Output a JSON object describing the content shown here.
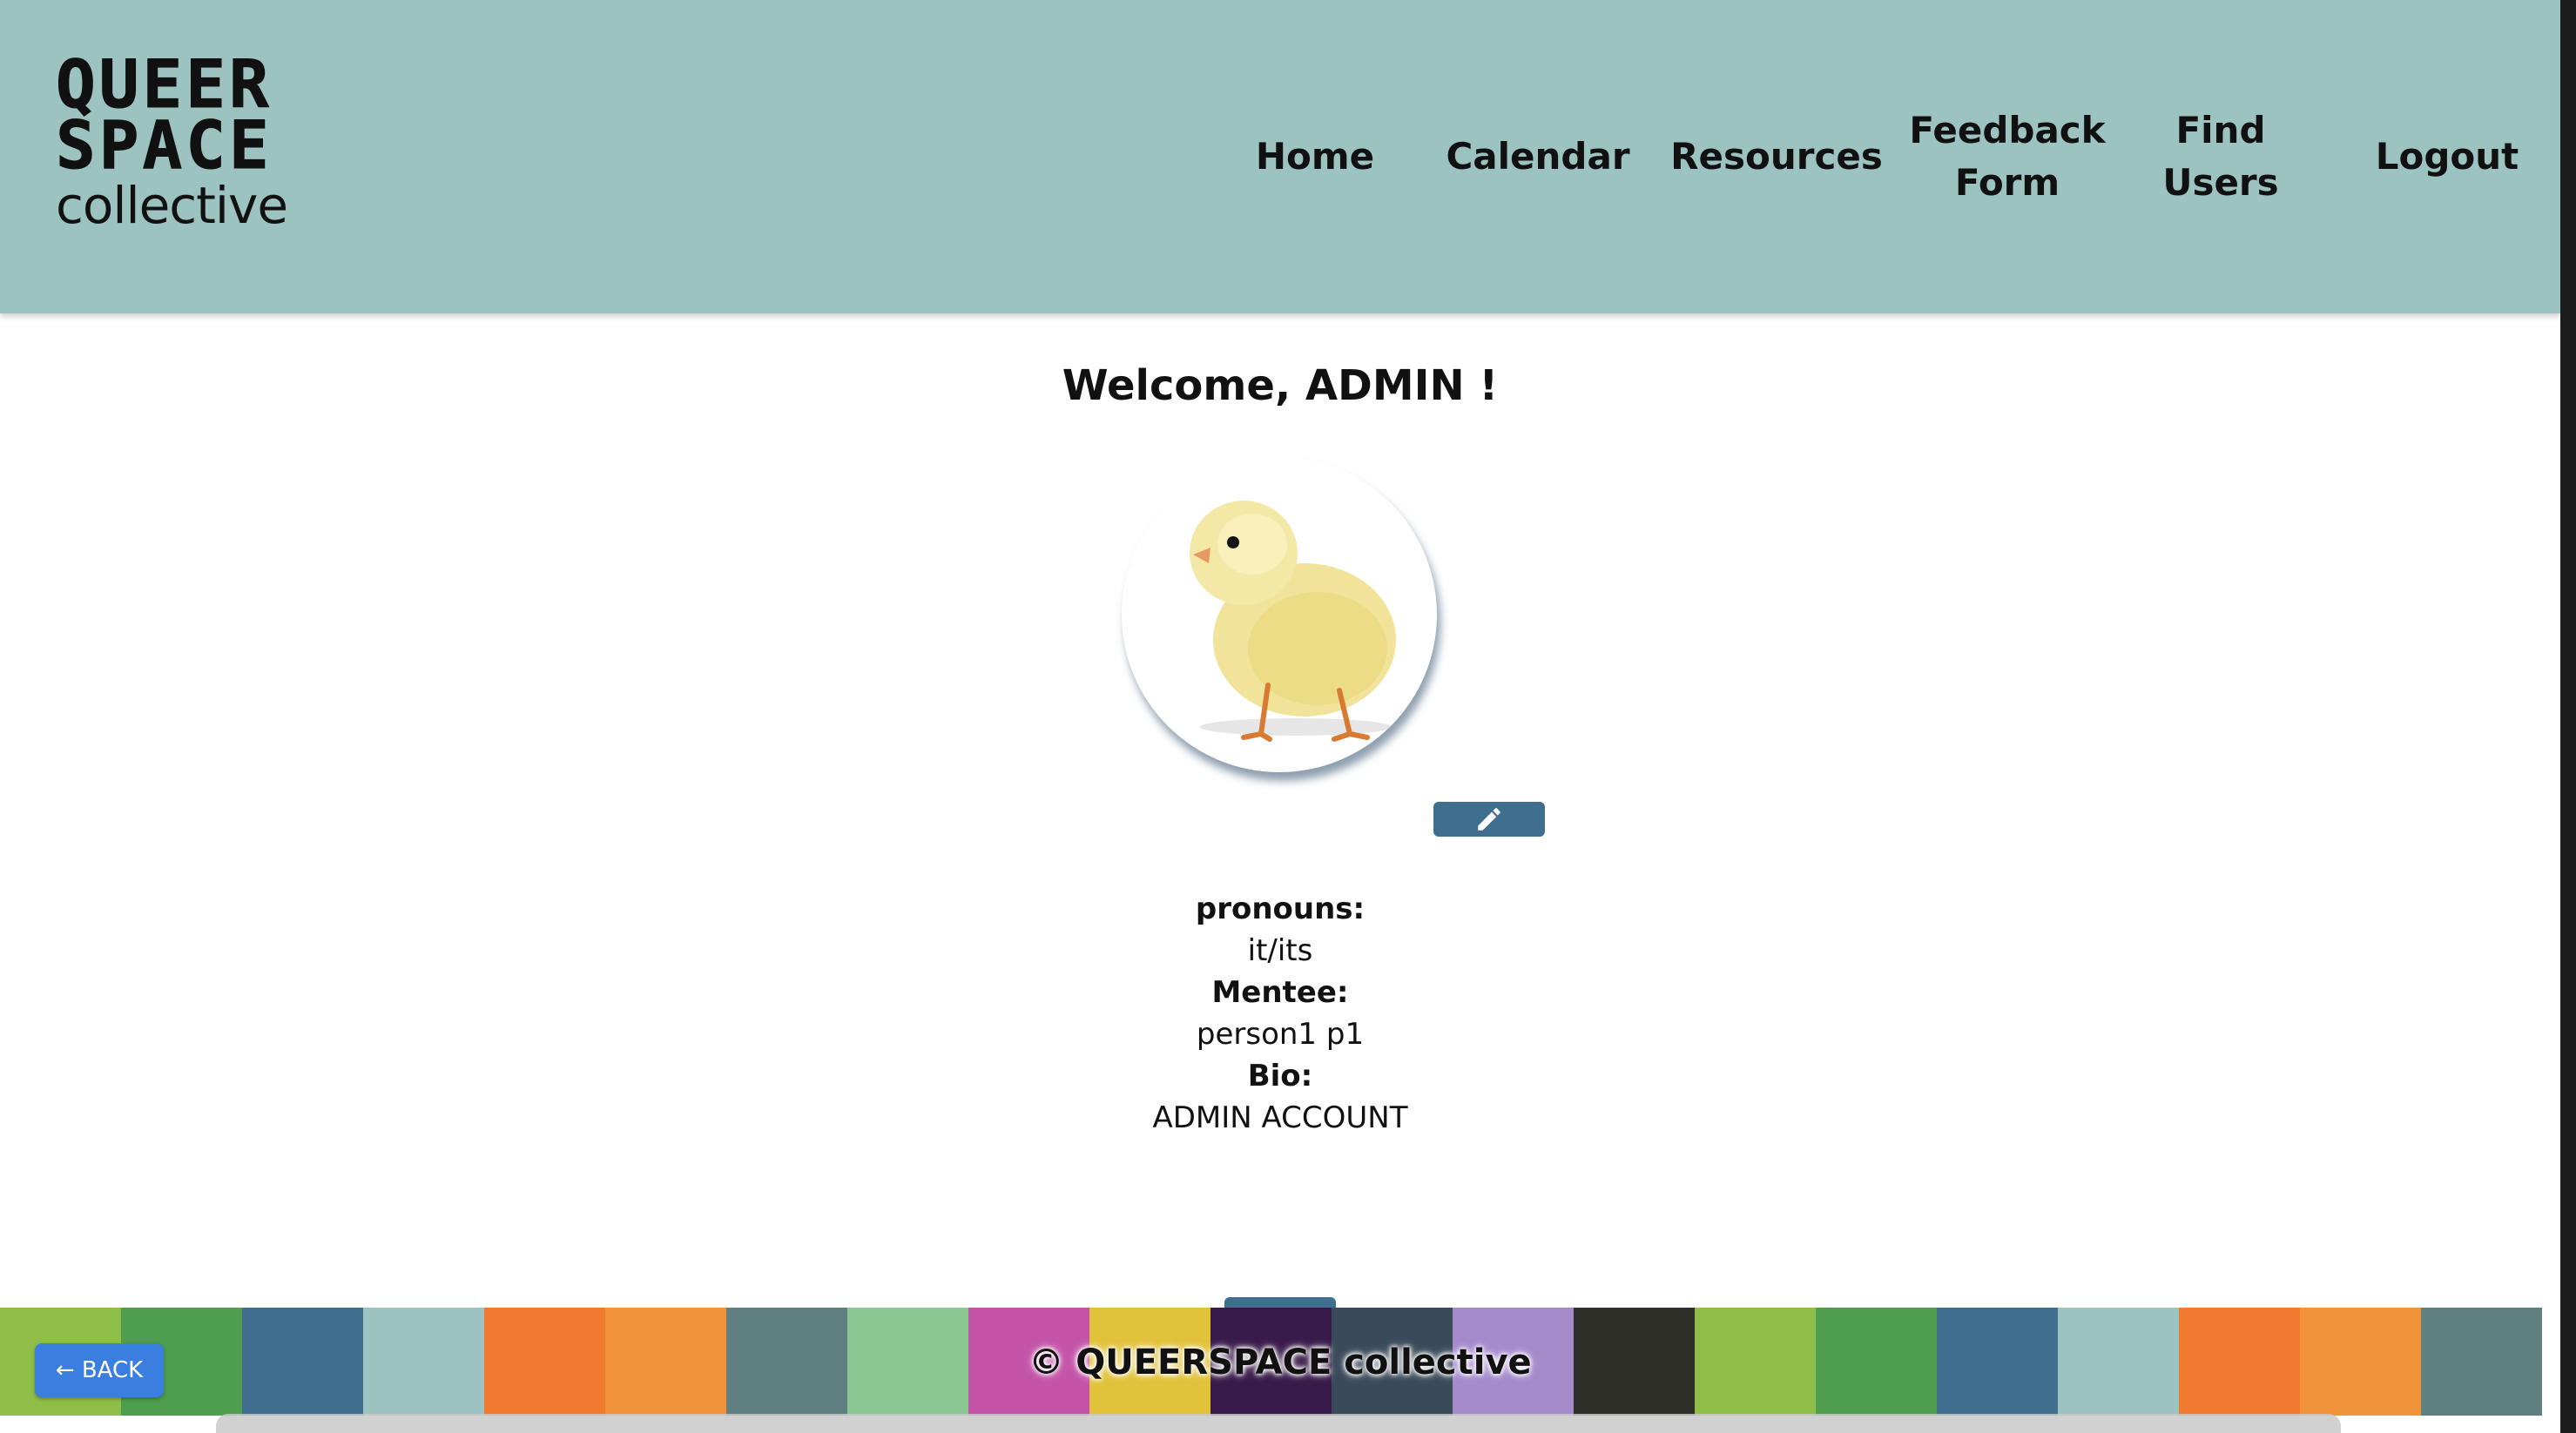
{
  "header": {
    "logo": {
      "line1": "QUEER",
      "line2": "SPACE",
      "line3": "collective"
    },
    "nav": [
      {
        "label": "Home"
      },
      {
        "label": "Calendar"
      },
      {
        "label": "Resources"
      },
      {
        "label": "Feedback Form"
      },
      {
        "label": "Find Users"
      },
      {
        "label": "Logout"
      }
    ]
  },
  "main": {
    "welcome": "Welcome, ADMIN !",
    "avatar_icon": "chick-image",
    "edit_icon": "pencil-icon",
    "fields": [
      {
        "label": "pronouns:",
        "value": "it/its"
      },
      {
        "label": "Mentee:",
        "value": "person1 p1"
      },
      {
        "label": "Bio:",
        "value": "ADMIN ACCOUNT"
      }
    ]
  },
  "footer": {
    "copyright": "© QUEERSPACE collective",
    "back_label": "← BACK",
    "tile_colors": [
      "#8fbf48",
      "#4f9e4f",
      "#3f6e8e",
      "#9dc3c0",
      "#f07a2f",
      "#f0933a",
      "#5f7f80",
      "#8ac792",
      "#c454a8",
      "#e2c23a",
      "#3a1a4a",
      "#3a4a5a",
      "#a58acc",
      "#2f2f2a",
      "#8fbf48",
      "#4f9e4f",
      "#3f6e8e",
      "#9dc3c0",
      "#f07a2f",
      "#f0933a",
      "#5f7f80"
    ]
  },
  "colors": {
    "header_bg": "#9dc3c0",
    "edit_button": "#3f6e8e",
    "back_button": "#3a7ee0"
  }
}
